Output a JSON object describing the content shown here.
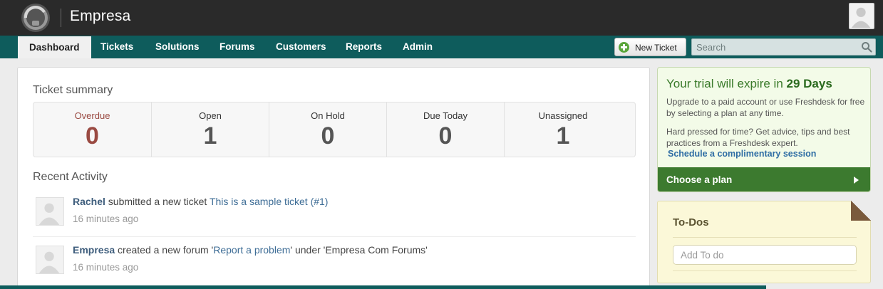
{
  "app": {
    "brand": "Empresa"
  },
  "nav": {
    "items": [
      {
        "label": "Dashboard",
        "active": true
      },
      {
        "label": "Tickets"
      },
      {
        "label": "Solutions"
      },
      {
        "label": "Forums"
      },
      {
        "label": "Customers"
      },
      {
        "label": "Reports"
      },
      {
        "label": "Admin"
      }
    ],
    "new_ticket_label": "New Ticket",
    "search_placeholder": "Search"
  },
  "ticket_summary": {
    "title": "Ticket summary",
    "cells": [
      {
        "label": "Overdue",
        "value": "0"
      },
      {
        "label": "Open",
        "value": "1"
      },
      {
        "label": "On Hold",
        "value": "0"
      },
      {
        "label": "Due Today",
        "value": "0"
      },
      {
        "label": "Unassigned",
        "value": "1"
      }
    ]
  },
  "recent_activity": {
    "title": "Recent Activity",
    "items": [
      {
        "who": "Rachel",
        "action": " submitted a new ticket ",
        "target": "This is a sample ticket (#1)",
        "suffix": "",
        "time": "16 minutes ago"
      },
      {
        "who": "Empresa",
        "action": " created a new forum '",
        "target": "Report a problem",
        "suffix": "' under 'Empresa Com Forums'",
        "time": "16 minutes ago"
      }
    ]
  },
  "trial": {
    "title_prefix": "Your trial will expire in ",
    "days": "29 Days",
    "text1": "Upgrade to a paid account or use Freshdesk for free by selecting a plan at any time.",
    "text2": "Hard pressed for time? Get advice, tips and best practices from a Freshdesk expert.",
    "link": "Schedule a complimentary session",
    "cta": "Choose a plan"
  },
  "todos": {
    "title": "To-Dos",
    "placeholder": "Add To do"
  },
  "colors": {
    "topbar": "#2a2a2a",
    "navbar": "#0e5c5c",
    "overdue": "#9a4a42",
    "trial_green": "#3c7a2f",
    "link_blue": "#2e6da4"
  }
}
